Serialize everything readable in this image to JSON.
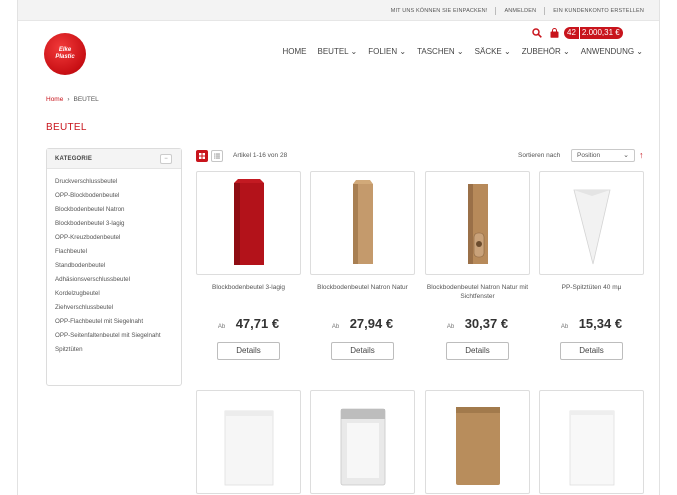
{
  "topbar": {
    "link1": "MIT UNS KÖNNEN SIE EINPACKEN!",
    "link2": "ANMELDEN",
    "link3": "EIN KUNDENKONTO ERSTELLEN"
  },
  "logo": {
    "line1": "Elke",
    "line2": "Plastic"
  },
  "cart": {
    "count": "42",
    "total": "2.000,31 €"
  },
  "nav": [
    {
      "label": "HOME"
    },
    {
      "label": "BEUTEL ⌄"
    },
    {
      "label": "FOLIEN ⌄"
    },
    {
      "label": "TASCHEN ⌄"
    },
    {
      "label": "SÄCKE ⌄"
    },
    {
      "label": "ZUBEHÖR ⌄"
    },
    {
      "label": "ANWENDUNG ⌄"
    }
  ],
  "breadcrumb": {
    "home": "Home",
    "separator": "›",
    "current": "BEUTEL"
  },
  "page_title": "BEUTEL",
  "sidebar": {
    "heading": "KATEGORIE",
    "collapse_symbol": "−",
    "items": [
      "Druckverschlussbeutel",
      "OPP-Blockbodenbeutel",
      "Blockbodenbeutel Natron",
      "Blockbodenbeutel 3-lagig",
      "OPP-Kreuzbodenbeutel",
      "Flachbeutel",
      "Standbodenbeutel",
      "Adhäsionsverschlussbeutel",
      "Kordelzugbeutel",
      "Ziehverschlussbeutel",
      "OPP-Flachbeutel mit Siegelnaht",
      "OPP-Seitenfaltenbeutel mit Siegelnaht",
      "Spitztüten"
    ]
  },
  "toolbar": {
    "count_text": "Artikel 1-16 von 28",
    "sort_label": "Sortieren nach",
    "sort_value": "Position",
    "sort_direction_icon": "arrow-up"
  },
  "products": [
    {
      "name": "Blockbodenbeutel 3-lagig",
      "price_prefix": "Ab",
      "price": "47,71 €",
      "button": "Details"
    },
    {
      "name": "Blockbodenbeutel Natron Natur",
      "price_prefix": "Ab",
      "price": "27,94 €",
      "button": "Details"
    },
    {
      "name": "Blockbodenbeutel Natron Natur mit Sichtfenster",
      "price_prefix": "Ab",
      "price": "30,37 €",
      "button": "Details"
    },
    {
      "name": "PP-Spitztüten 40 mμ",
      "price_prefix": "Ab",
      "price": "15,34 €",
      "button": "Details"
    }
  ],
  "colors": {
    "brand": "#c8141c",
    "kraft": "#c49a6c",
    "bag_red": "#b3121a"
  }
}
